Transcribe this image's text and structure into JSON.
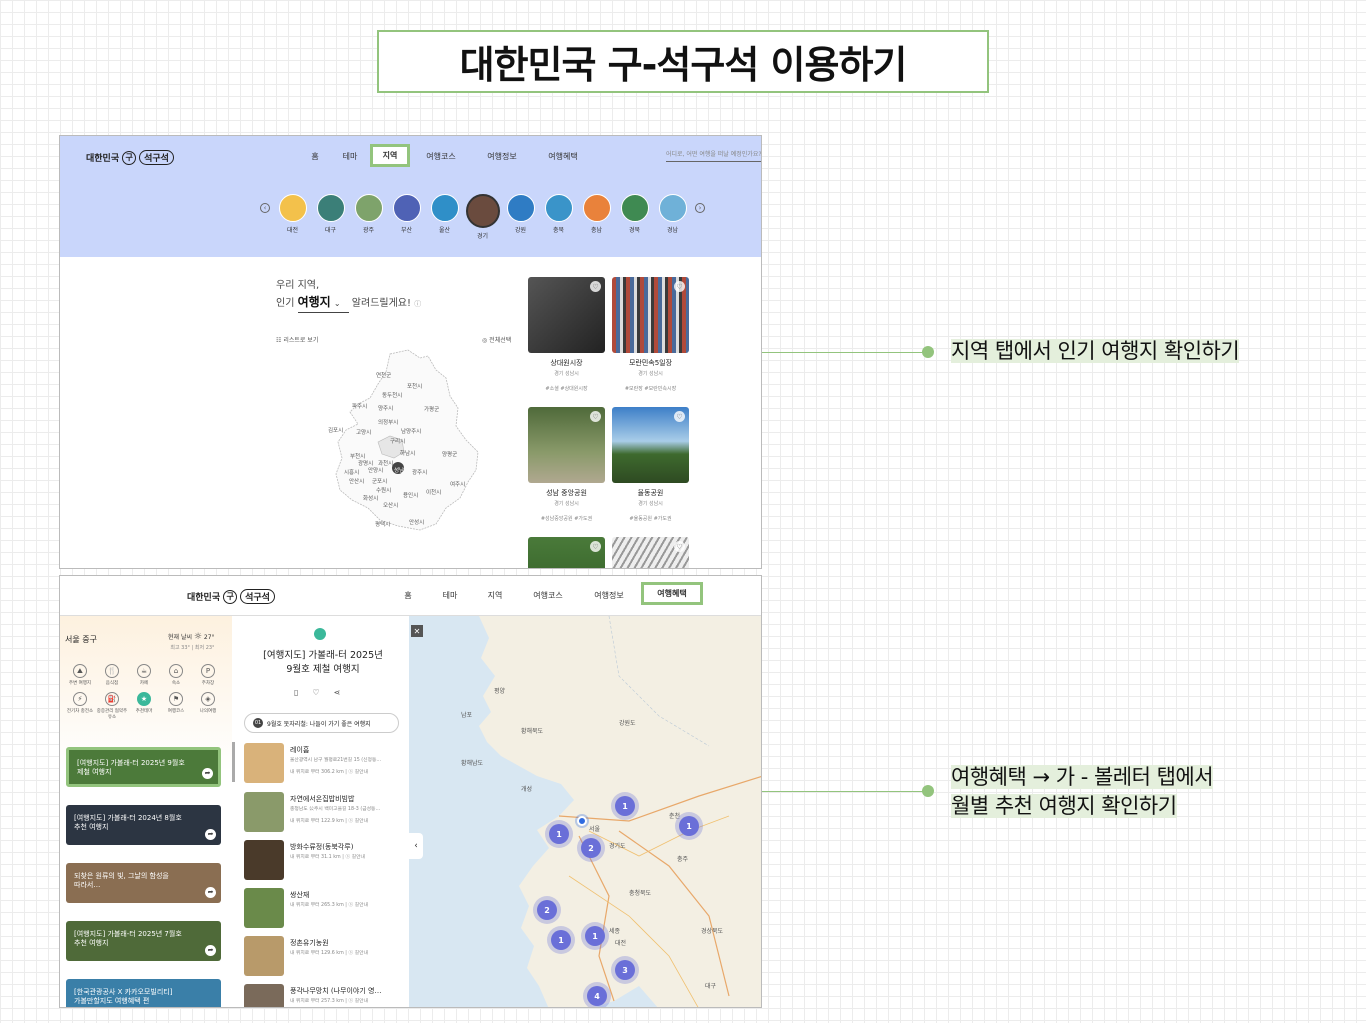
{
  "title": "대한민국 구-석구석 이용하기",
  "annotations": {
    "a1": "지역 탭에서 인기 여행지 확인하기",
    "a2_line1": "여행혜택 → 가 - 볼레터 탭에서",
    "a2_line2": "월별 추천 여행지 확인하기"
  },
  "logo": {
    "prefix": "대한민국",
    "mark": "구",
    "brand": "석구석"
  },
  "shot1": {
    "nav": [
      "홈",
      "테마",
      "지역",
      "여행코스",
      "여행정보",
      "여행혜택"
    ],
    "active_nav": "지역",
    "search_placeholder": "어디로, 어떤 여행을 떠날 예정인가요?",
    "regions": [
      {
        "label": "대전",
        "color": "#f3c14b"
      },
      {
        "label": "대구",
        "color": "#3b7f78"
      },
      {
        "label": "광주",
        "color": "#7ea36b"
      },
      {
        "label": "부산",
        "color": "#4f62b5"
      },
      {
        "label": "울산",
        "color": "#2f8fc8"
      },
      {
        "label": "경기",
        "color": "#6a4b3e"
      },
      {
        "label": "강원",
        "color": "#2f7cc4"
      },
      {
        "label": "충북",
        "color": "#3a94c9"
      },
      {
        "label": "충남",
        "color": "#e9823b"
      },
      {
        "label": "경북",
        "color": "#3f8a52"
      },
      {
        "label": "경남",
        "color": "#6fb1d8"
      }
    ],
    "selected_region": "경기",
    "heading_line1": "우리 지역,",
    "heading_prefix": "인기",
    "heading_dropdown": "여행지",
    "heading_suffix": "알려드릴게요!",
    "list_view": "리스트로 보기",
    "select_all": "전체선택",
    "map_labels": [
      "연천군",
      "포천시",
      "동두천시",
      "파주시",
      "양주시",
      "가평군",
      "의정부시",
      "김포시",
      "고양시",
      "남양주시",
      "구리시",
      "양평군",
      "하남시",
      "부천시",
      "광명시",
      "과천시",
      "성남",
      "광주시",
      "시흥시",
      "안양시",
      "군포시",
      "안산시",
      "수원시",
      "용인시",
      "이천시",
      "여주시",
      "화성시",
      "오산시",
      "평택시",
      "안성시"
    ],
    "cards": [
      {
        "name": "상대원시장",
        "loc": "경기 성남시",
        "tags": "#소셜  #상대원시장",
        "color": "#3d3d3d"
      },
      {
        "name": "모란민속5일장",
        "loc": "경기 성남시",
        "tags": "#모란장  #모란민속시장",
        "color": "#8a6a5a"
      },
      {
        "name": "성남 중앙공원",
        "loc": "경기 성남시",
        "tags": "#성남중앙공원  #가도권",
        "color": "#6f8a55"
      },
      {
        "name": "율동공원",
        "loc": "경기 성남시",
        "tags": "#율동공원  #가도권",
        "color": "#5a8fc4"
      }
    ]
  },
  "shot2": {
    "nav": [
      "홈",
      "테마",
      "지역",
      "여행코스",
      "여행정보",
      "여행혜택"
    ],
    "active_nav": "여행혜택",
    "location": "서울 중구",
    "weather_now": "현재 날씨",
    "temp": "27°",
    "temp_range": "최고 33° | 최저 23°",
    "icons": [
      {
        "label": "주변 여행지",
        "glyph": "⛰"
      },
      {
        "label": "음식점",
        "glyph": "🍴"
      },
      {
        "label": "카페",
        "glyph": "☕"
      },
      {
        "label": "숙소",
        "glyph": "⌂"
      },
      {
        "label": "주차장",
        "glyph": "P"
      },
      {
        "label": "전기차 충전소",
        "glyph": "⚡"
      },
      {
        "label": "중증관리 협약주유소",
        "glyph": "⛽"
      },
      {
        "label": "추천테마",
        "glyph": "★"
      },
      {
        "label": "여행코스",
        "glyph": "⚑"
      },
      {
        "label": "나의여행",
        "glyph": "◈"
      }
    ],
    "banners": [
      {
        "text": "[여행지도] 가볼래-터 2025년 9월호\n제철 여행지",
        "color": "#4c7a3a"
      },
      {
        "text": "[여행지도] 가볼래-터 2024년 8월호\n추천 여행지",
        "color": "#2c3542"
      },
      {
        "text": "되찾은 원류의 빛, 그날의 함성을\n따라서…",
        "color": "#8a6e52"
      },
      {
        "text": "[여행지도] 가볼래-터 2025년 7월호\n추천 여행지",
        "color": "#4f6a39"
      },
      {
        "text": "[한국관광공사 X 카카오모빌리티]\n가볼만할지도 여행혜택 편",
        "color": "#3a7fa8"
      }
    ],
    "panel_title_1": "[여행지도] 가볼래-터 2025년",
    "panel_title_2": "9월호 제철 여행지",
    "chip_no": "01",
    "chip_text": "9월호 뚯자리철: 나들이 가기 좋은 여행지",
    "places": [
      {
        "name": "레이흠",
        "addr": "울산광역시 남구 월평로21번길 15 (신정동…",
        "dist": "내 위치로 부터 306.2 km  |  ⓢ 길안내",
        "color": "#d9b27a"
      },
      {
        "name": "자연에서온집밥비빔밥",
        "addr": "충청남도 公주시 백미고을길 18-3 (금성동…",
        "dist": "내 위치로 부터 122.9 km  |  ⓢ 길안내",
        "color": "#8a9a6a"
      },
      {
        "name": "방화수류정(동북각루)",
        "addr": "내 위치로 부터 31.1 km  |  ⓢ 길안내",
        "dist": "",
        "color": "#4a3a2a"
      },
      {
        "name": "쌍산재",
        "addr": "내 위치로 부터 265.3 km  |  ⓢ 길안내",
        "dist": "",
        "color": "#6a8a4a"
      },
      {
        "name": "정촌유기농원",
        "addr": "내 위치로 부터 129.6 km  |  ⓢ 길안내",
        "dist": "",
        "color": "#b89a6a"
      },
      {
        "name": "풍각나무망치 (나무이야기 영…",
        "addr": "내 위치로 부터 257.3 km  |  ⓢ 길안내",
        "dist": "",
        "color": "#7a6a5a"
      }
    ],
    "map_labels": [
      "평양",
      "남포",
      "황해북도",
      "강원도",
      "황해남도",
      "개성",
      "서울",
      "경기도",
      "충청북도",
      "대전",
      "세종",
      "경상북도",
      "대구",
      "충주",
      "춘천"
    ],
    "clusters": [
      "1",
      "1",
      "1",
      "2",
      "2",
      "1",
      "1",
      "3",
      "4"
    ]
  }
}
